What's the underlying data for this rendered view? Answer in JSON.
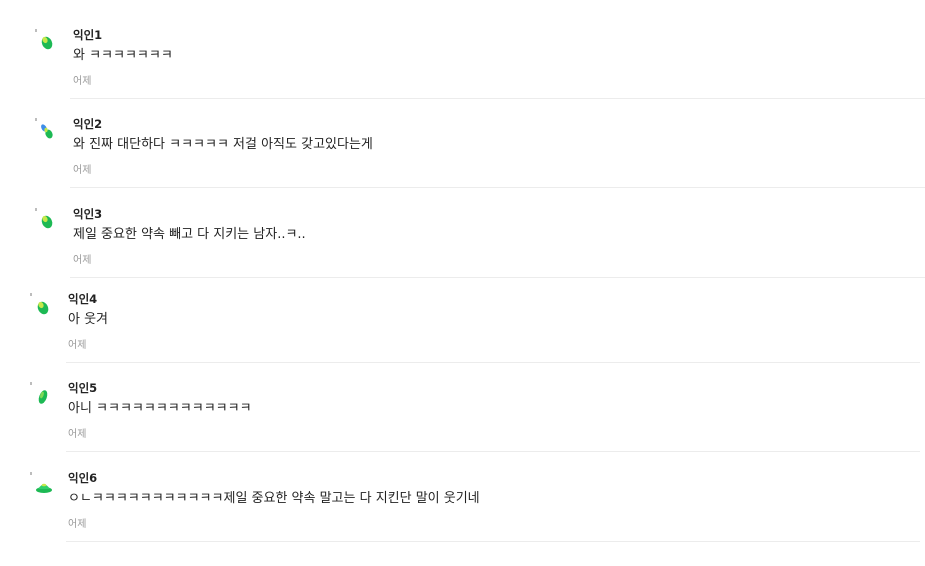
{
  "comments": [
    {
      "author": "익인1",
      "content": "와 ㅋㅋㅋㅋㅋㅋㅋ",
      "time": "어제",
      "avatar_icon": "green-leaf-icon"
    },
    {
      "author": "익인2",
      "content": "와 진짜 대단하다 ㅋㅋㅋㅋㅋ 저걸 아직도 갖고있다는게",
      "time": "어제",
      "avatar_icon": "green-sprout-icon"
    },
    {
      "author": "익인3",
      "content": "제일 중요한 약속 빼고 다 지키는 남자..ㅋ..",
      "time": "어제",
      "avatar_icon": "green-leaf-icon"
    },
    {
      "author": "익인4",
      "content": "아 웃겨",
      "time": "어제",
      "avatar_icon": "green-leaf-icon"
    },
    {
      "author": "익인5",
      "content": "아니 ㅋㅋㅋㅋㅋㅋㅋㅋㅋㅋㅋㅋㅋ",
      "time": "어제",
      "avatar_icon": "green-leaf-icon"
    },
    {
      "author": "익인6",
      "content": "ㅇㄴㅋㅋㅋㅋㅋㅋㅋㅋㅋㅋㅋ제일 중요한 약속 말고는 다 지킨단 말이 웃기네",
      "time": "어제",
      "avatar_icon": "green-hat-icon"
    }
  ],
  "colors": {
    "author_text": "#222222",
    "content_text": "#222222",
    "time_text": "#999999",
    "divider": "#ececec",
    "avatar_green": "#1db954",
    "avatar_lime": "#c6e84a",
    "avatar_blue": "#3d8de8"
  }
}
